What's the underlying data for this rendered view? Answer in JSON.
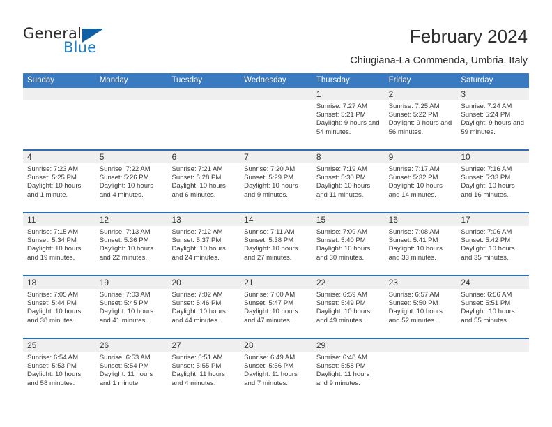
{
  "brand": {
    "name_top": "General",
    "name_bottom": "Blue",
    "accent_color": "#1f7ec8",
    "triangle_color": "#0e5fa4"
  },
  "header": {
    "title": "February 2024",
    "subtitle": "Chiugiana-La Commenda, Umbria, Italy"
  },
  "theme": {
    "header_blue": "#3a7ac0",
    "row_divider_blue": "#2e6daf",
    "day_number_band": "#efefef",
    "cell_background": "#ffffff",
    "text_color": "#3a3a3a"
  },
  "weekdays": [
    "Sunday",
    "Monday",
    "Tuesday",
    "Wednesday",
    "Thursday",
    "Friday",
    "Saturday"
  ],
  "weeks": [
    [
      {
        "day": "",
        "sunrise": "",
        "sunset": "",
        "daylight": ""
      },
      {
        "day": "",
        "sunrise": "",
        "sunset": "",
        "daylight": ""
      },
      {
        "day": "",
        "sunrise": "",
        "sunset": "",
        "daylight": ""
      },
      {
        "day": "",
        "sunrise": "",
        "sunset": "",
        "daylight": ""
      },
      {
        "day": "1",
        "sunrise": "Sunrise: 7:27 AM",
        "sunset": "Sunset: 5:21 PM",
        "daylight": "Daylight: 9 hours and 54 minutes."
      },
      {
        "day": "2",
        "sunrise": "Sunrise: 7:25 AM",
        "sunset": "Sunset: 5:22 PM",
        "daylight": "Daylight: 9 hours and 56 minutes."
      },
      {
        "day": "3",
        "sunrise": "Sunrise: 7:24 AM",
        "sunset": "Sunset: 5:24 PM",
        "daylight": "Daylight: 9 hours and 59 minutes."
      }
    ],
    [
      {
        "day": "4",
        "sunrise": "Sunrise: 7:23 AM",
        "sunset": "Sunset: 5:25 PM",
        "daylight": "Daylight: 10 hours and 1 minute."
      },
      {
        "day": "5",
        "sunrise": "Sunrise: 7:22 AM",
        "sunset": "Sunset: 5:26 PM",
        "daylight": "Daylight: 10 hours and 4 minutes."
      },
      {
        "day": "6",
        "sunrise": "Sunrise: 7:21 AM",
        "sunset": "Sunset: 5:28 PM",
        "daylight": "Daylight: 10 hours and 6 minutes."
      },
      {
        "day": "7",
        "sunrise": "Sunrise: 7:20 AM",
        "sunset": "Sunset: 5:29 PM",
        "daylight": "Daylight: 10 hours and 9 minutes."
      },
      {
        "day": "8",
        "sunrise": "Sunrise: 7:19 AM",
        "sunset": "Sunset: 5:30 PM",
        "daylight": "Daylight: 10 hours and 11 minutes."
      },
      {
        "day": "9",
        "sunrise": "Sunrise: 7:17 AM",
        "sunset": "Sunset: 5:32 PM",
        "daylight": "Daylight: 10 hours and 14 minutes."
      },
      {
        "day": "10",
        "sunrise": "Sunrise: 7:16 AM",
        "sunset": "Sunset: 5:33 PM",
        "daylight": "Daylight: 10 hours and 16 minutes."
      }
    ],
    [
      {
        "day": "11",
        "sunrise": "Sunrise: 7:15 AM",
        "sunset": "Sunset: 5:34 PM",
        "daylight": "Daylight: 10 hours and 19 minutes."
      },
      {
        "day": "12",
        "sunrise": "Sunrise: 7:13 AM",
        "sunset": "Sunset: 5:36 PM",
        "daylight": "Daylight: 10 hours and 22 minutes."
      },
      {
        "day": "13",
        "sunrise": "Sunrise: 7:12 AM",
        "sunset": "Sunset: 5:37 PM",
        "daylight": "Daylight: 10 hours and 24 minutes."
      },
      {
        "day": "14",
        "sunrise": "Sunrise: 7:11 AM",
        "sunset": "Sunset: 5:38 PM",
        "daylight": "Daylight: 10 hours and 27 minutes."
      },
      {
        "day": "15",
        "sunrise": "Sunrise: 7:09 AM",
        "sunset": "Sunset: 5:40 PM",
        "daylight": "Daylight: 10 hours and 30 minutes."
      },
      {
        "day": "16",
        "sunrise": "Sunrise: 7:08 AM",
        "sunset": "Sunset: 5:41 PM",
        "daylight": "Daylight: 10 hours and 33 minutes."
      },
      {
        "day": "17",
        "sunrise": "Sunrise: 7:06 AM",
        "sunset": "Sunset: 5:42 PM",
        "daylight": "Daylight: 10 hours and 35 minutes."
      }
    ],
    [
      {
        "day": "18",
        "sunrise": "Sunrise: 7:05 AM",
        "sunset": "Sunset: 5:44 PM",
        "daylight": "Daylight: 10 hours and 38 minutes."
      },
      {
        "day": "19",
        "sunrise": "Sunrise: 7:03 AM",
        "sunset": "Sunset: 5:45 PM",
        "daylight": "Daylight: 10 hours and 41 minutes."
      },
      {
        "day": "20",
        "sunrise": "Sunrise: 7:02 AM",
        "sunset": "Sunset: 5:46 PM",
        "daylight": "Daylight: 10 hours and 44 minutes."
      },
      {
        "day": "21",
        "sunrise": "Sunrise: 7:00 AM",
        "sunset": "Sunset: 5:47 PM",
        "daylight": "Daylight: 10 hours and 47 minutes."
      },
      {
        "day": "22",
        "sunrise": "Sunrise: 6:59 AM",
        "sunset": "Sunset: 5:49 PM",
        "daylight": "Daylight: 10 hours and 49 minutes."
      },
      {
        "day": "23",
        "sunrise": "Sunrise: 6:57 AM",
        "sunset": "Sunset: 5:50 PM",
        "daylight": "Daylight: 10 hours and 52 minutes."
      },
      {
        "day": "24",
        "sunrise": "Sunrise: 6:56 AM",
        "sunset": "Sunset: 5:51 PM",
        "daylight": "Daylight: 10 hours and 55 minutes."
      }
    ],
    [
      {
        "day": "25",
        "sunrise": "Sunrise: 6:54 AM",
        "sunset": "Sunset: 5:53 PM",
        "daylight": "Daylight: 10 hours and 58 minutes."
      },
      {
        "day": "26",
        "sunrise": "Sunrise: 6:53 AM",
        "sunset": "Sunset: 5:54 PM",
        "daylight": "Daylight: 11 hours and 1 minute."
      },
      {
        "day": "27",
        "sunrise": "Sunrise: 6:51 AM",
        "sunset": "Sunset: 5:55 PM",
        "daylight": "Daylight: 11 hours and 4 minutes."
      },
      {
        "day": "28",
        "sunrise": "Sunrise: 6:49 AM",
        "sunset": "Sunset: 5:56 PM",
        "daylight": "Daylight: 11 hours and 7 minutes."
      },
      {
        "day": "29",
        "sunrise": "Sunrise: 6:48 AM",
        "sunset": "Sunset: 5:58 PM",
        "daylight": "Daylight: 11 hours and 9 minutes."
      },
      {
        "day": "",
        "sunrise": "",
        "sunset": "",
        "daylight": ""
      },
      {
        "day": "",
        "sunrise": "",
        "sunset": "",
        "daylight": ""
      }
    ]
  ]
}
